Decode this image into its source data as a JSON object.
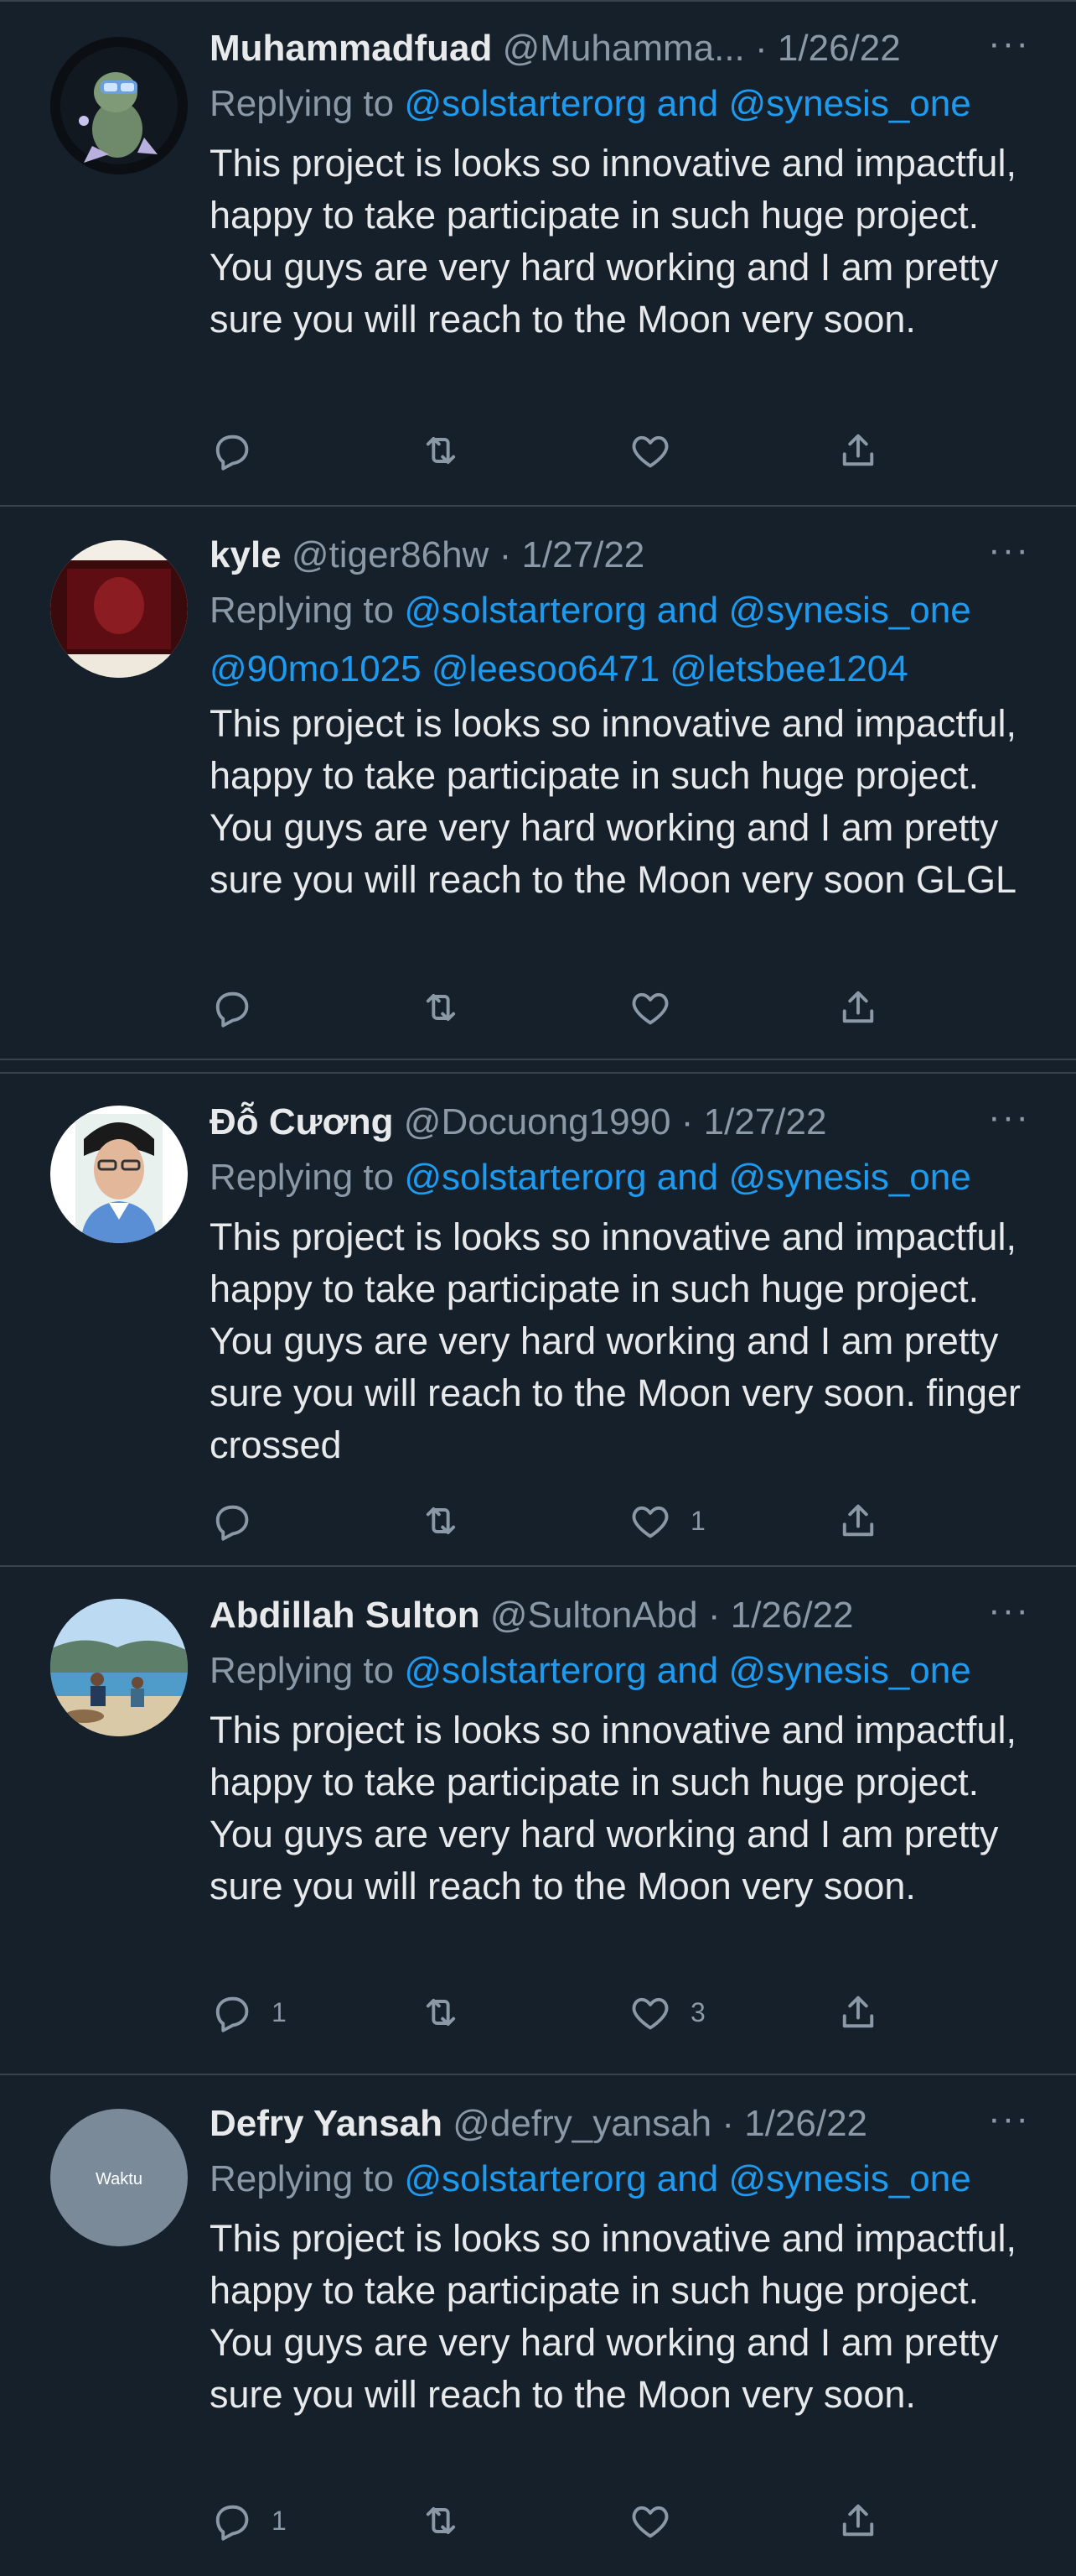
{
  "colors": {
    "background": "#15202b",
    "divider": "#38444d",
    "text_primary": "#e7e9ea",
    "text_secondary": "#8b98a5",
    "link": "#1d9bf0"
  },
  "tweets": [
    {
      "name": "Muhammadfuad",
      "handle": "@Muhamma...",
      "dot": "·",
      "date": "1/26/22",
      "more": "···",
      "replying_label": "Replying to",
      "replying_to": "@solstarterorg and @synesis_one",
      "extra_mentions": "",
      "text": "This project is looks so innovative and impactful, happy to take participate in such huge project. You guys are very hard working and I am pretty sure you will reach to the Moon very soon.",
      "reply_count": "",
      "retweet_count": "",
      "like_count": "",
      "avatar_icon": "cartoon-character-avatar"
    },
    {
      "name": "kyle",
      "handle": "@tiger86hw",
      "dot": "·",
      "date": "1/27/22",
      "more": "···",
      "replying_label": "Replying to",
      "replying_to": "@solstarterorg and @synesis_one",
      "extra_mentions": "@90mo1025 @leesoo6471 @letsbee1204",
      "text": "This project is looks so innovative and impactful, happy to take participate in such huge project. You guys are very hard working and I am pretty sure you will reach to the Moon very soon GLGL",
      "reply_count": "",
      "retweet_count": "",
      "like_count": "",
      "avatar_icon": "red-photo-avatar"
    },
    {
      "name": "Đỗ Cương",
      "handle": "@Docuong1990",
      "dot": "·",
      "date": "1/27/22",
      "more": "···",
      "replying_label": "Replying to",
      "replying_to": "@solstarterorg and @synesis_one",
      "extra_mentions": "",
      "text": "This project is looks so innovative and impactful, happy to take participate in such huge project. You guys are very hard working and I am pretty sure you will reach to the Moon very soon. finger crossed",
      "reply_count": "",
      "retweet_count": "",
      "like_count": "1",
      "avatar_icon": "portrait-photo-avatar"
    },
    {
      "name": "Abdillah Sulton",
      "handle": "@SultonAbd",
      "dot": "·",
      "date": "1/26/22",
      "more": "···",
      "replying_label": "Replying to",
      "replying_to": "@solstarterorg and @synesis_one",
      "extra_mentions": "",
      "text": "This project is looks so innovative and impactful, happy to take participate in such huge project. You guys are very hard working and I am pretty sure you will reach to the Moon very soon.",
      "reply_count": "1",
      "retweet_count": "",
      "like_count": "3",
      "avatar_icon": "beach-photo-avatar"
    },
    {
      "name": "Defry Yansah",
      "handle": "@defry_yansah",
      "dot": "·",
      "date": "1/26/22",
      "more": "···",
      "replying_label": "Replying to",
      "replying_to": "@solstarterorg and @synesis_one",
      "extra_mentions": "",
      "text": "This project is looks so innovative and impactful, happy to take participate in such huge project. You guys are very hard working and I am pretty sure you will reach to the Moon very soon.",
      "reply_count": "1",
      "retweet_count": "",
      "like_count": "",
      "avatar_icon": "gray-placeholder-avatar",
      "avatar_text": "Waktu"
    }
  ]
}
